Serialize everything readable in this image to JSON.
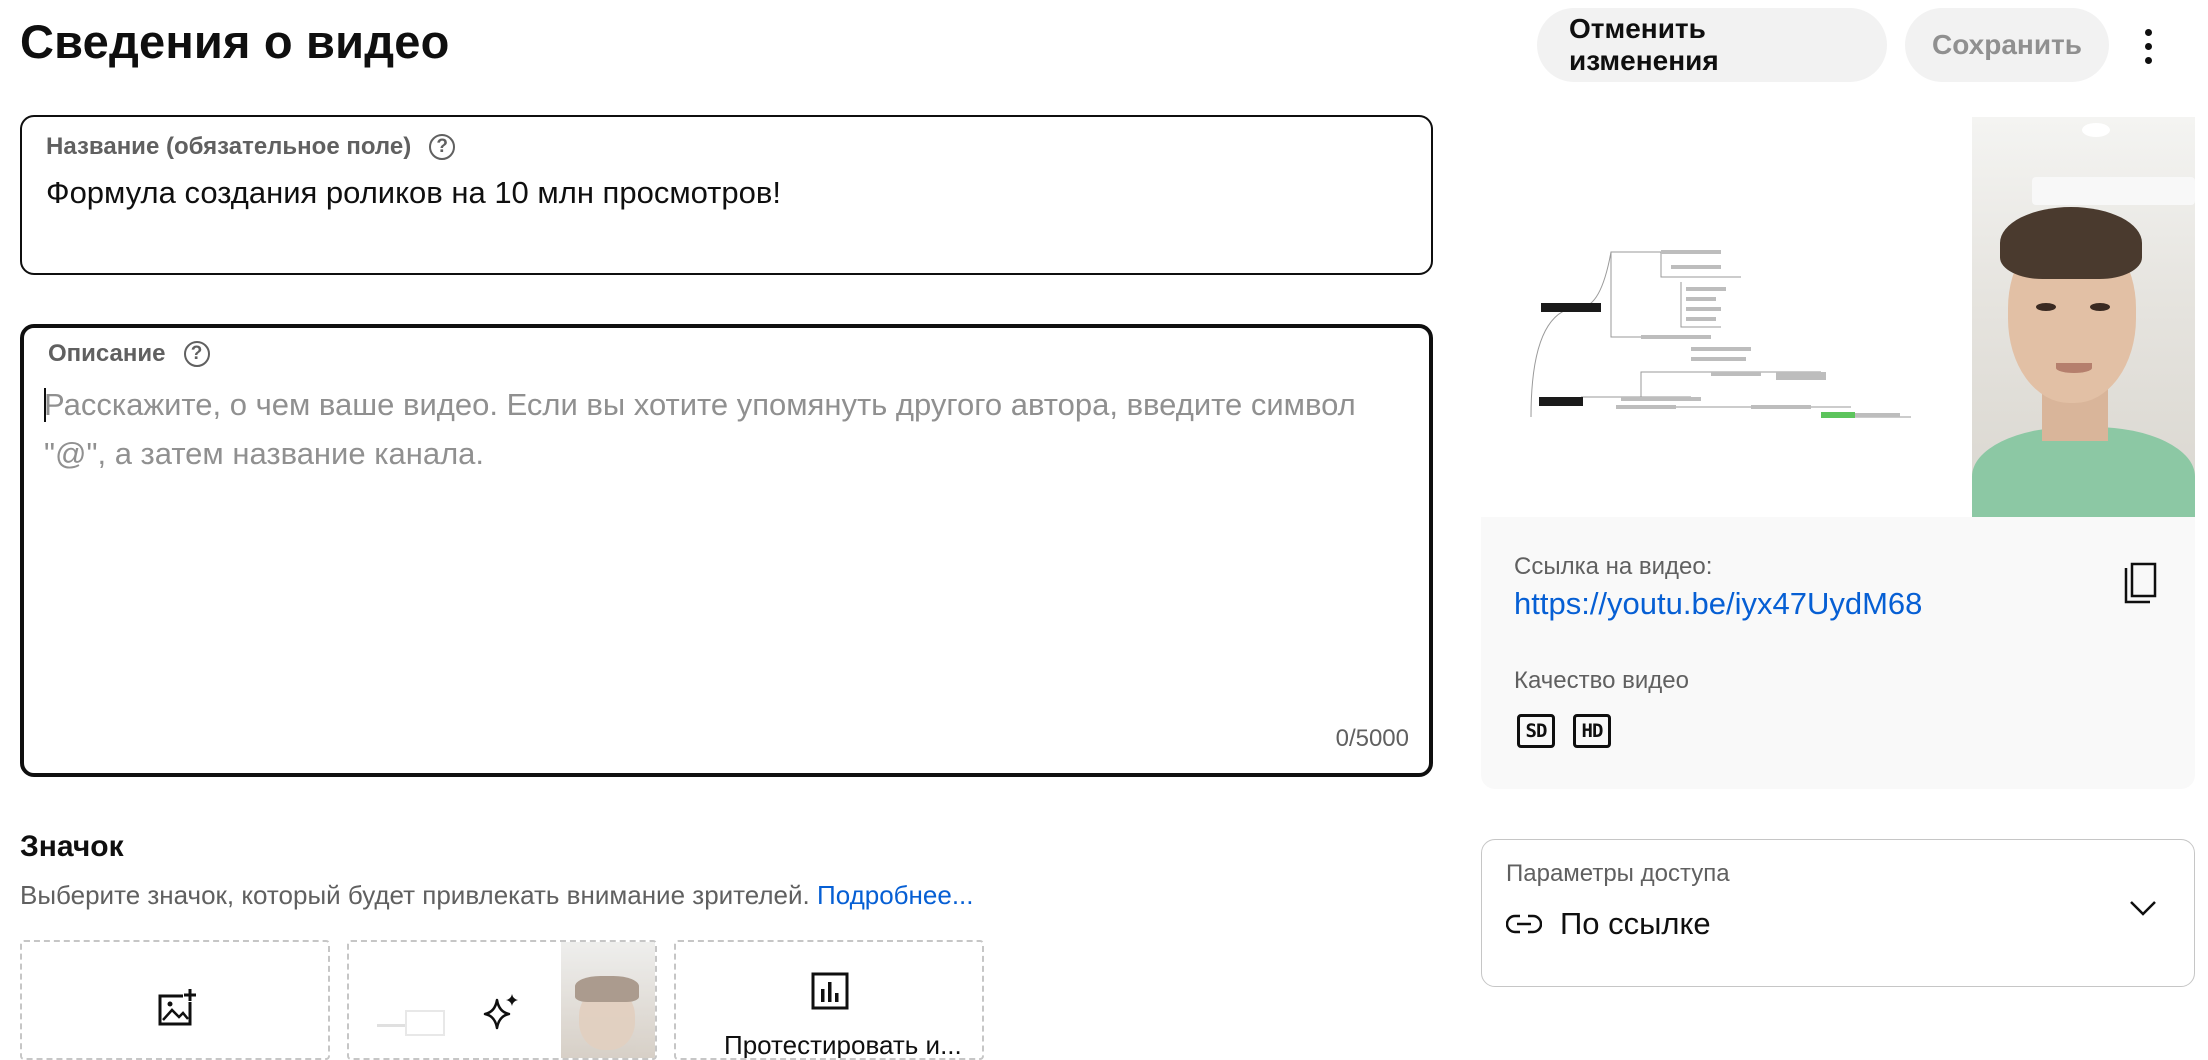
{
  "header": {
    "title": "Сведения о видео",
    "undo_label": "Отменить изменения",
    "save_label": "Сохранить",
    "more_icon": "more-vert-icon"
  },
  "title_field": {
    "label": "Название (обязательное поле)",
    "value": "Формула создания роликов на 10 млн просмотров!",
    "help_icon": "help-circle-icon"
  },
  "description_field": {
    "label": "Описание",
    "placeholder": "Расскажите, о чем ваше видео. Если вы хотите упомянуть другого автора, введите символ \"@\", а затем название канала.",
    "counter": "0/5000",
    "help_icon": "help-circle-icon"
  },
  "thumbnail": {
    "title": "Значок",
    "subtitle": "Выберите значок, который будет привлекать внимание зрителей.",
    "link": "Подробнее...",
    "cards": [
      {
        "icon": "add-image-icon"
      },
      {
        "icon": "sparkle-icon"
      },
      {
        "icon": "bar-chart-icon",
        "label": "Протестировать и..."
      }
    ]
  },
  "video_info": {
    "link_label": "Ссылка на видео:",
    "link_url": "https://youtu.be/iyx47UydM68",
    "quality_label": "Качество видео",
    "quality_badges": [
      "SD",
      "HD"
    ],
    "copy_icon": "copy-icon"
  },
  "access": {
    "label": "Параметры доступа",
    "value": "По ссылке",
    "icon": "link-icon",
    "dropdown_icon": "chevron-down-icon"
  },
  "colors": {
    "link": "#065fd4",
    "secondary_text": "#606060",
    "button_bg": "#f2f2f2"
  }
}
